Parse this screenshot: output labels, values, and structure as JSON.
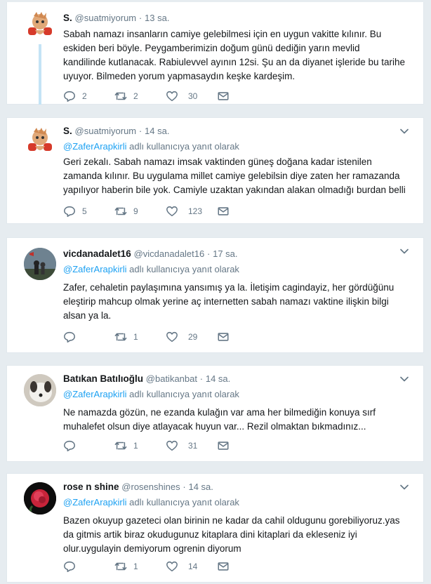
{
  "tweets": [
    {
      "name": "S.",
      "handle": "@suatmiyorum",
      "time": "13 sa.",
      "reply_to": "",
      "lines": [
        "Sabah namazı insanların camiye gelebilmesi için en uygun vakitte kılınır. Bu",
        "eskiden beri böyle. Peygamberimizin doğum günü dediğin yarın mevlid",
        "kandilinde kutlanacak. Rabiulevvel ayının 12si. Şu an da diyanet işleride bu tarihe",
        "uyuyor. Bilmeden yorum yapmasaydın keşke kardeşim."
      ],
      "replies": "2",
      "retweets": "2",
      "likes": "30"
    },
    {
      "name": "S.",
      "handle": "@suatmiyorum",
      "time": "14 sa.",
      "reply_to": "@ZaferArapkirli",
      "reply_suffix": "adlı kullanıcıya yanıt olarak",
      "lines": [
        "Geri zekalı. Sabah namazı imsak vaktinden güneş doğana kadar istenilen",
        "zamanda kılınır. Bu uygulama millet camiye gelebilsin diye zaten her ramazanda",
        "yapılıyor haberin bile yok. Camiyle uzaktan yakından alakan olmadığı burdan belli"
      ],
      "replies": "5",
      "retweets": "9",
      "likes": "123"
    },
    {
      "name": "vicdanadalet16",
      "handle": "@vicdanadalet16",
      "time": "17 sa.",
      "reply_to": "@ZaferArapkirli",
      "reply_suffix": "adlı kullanıcıya yanıt olarak",
      "lines": [
        "Zafer, cehaletin paylaşımına yansımış ya la. İletişim cagindayiz, her gördüğünu",
        "eleştirip mahcup olmak yerine aç internetten sabah namazı vaktine ilişkin bilgi",
        "alsan ya la."
      ],
      "replies": "",
      "retweets": "1",
      "likes": "29"
    },
    {
      "name": "Batıkan Batılıoğlu",
      "handle": "@batikanbat",
      "time": "14 sa.",
      "reply_to": "@ZaferArapkirli",
      "reply_suffix": "adlı kullanıcıya yanıt olarak",
      "lines": [
        "Ne namazda gözün, ne ezanda kulağın var ama her bilmediğin konuya sırf",
        "muhalefet olsun diye atlayacak huyun var... Rezil olmaktan bıkmadınız..."
      ],
      "replies": "",
      "retweets": "1",
      "likes": "31"
    },
    {
      "name": "rose n shine",
      "handle": "@rosenshines",
      "time": "14 sa.",
      "reply_to": "@ZaferArapkirli",
      "reply_suffix": "adlı kullanıcıya yanıt olarak",
      "lines": [
        "Bazen okuyup gazeteci olan birinin ne kadar da cahil oldugunu gorebiliyoruz.yas",
        "da gitmis artik biraz okudugunuz kitaplara dini kitaplari da ekleseniz iyi",
        "olur.uygulayin demiyorum ogrenin diyorum"
      ],
      "replies": "",
      "retweets": "1",
      "likes": "14"
    }
  ],
  "icons": {
    "reply": "reply-icon",
    "retweet": "retweet-icon",
    "like": "heart-icon",
    "dm": "envelope-icon",
    "more": "chevron-down-icon"
  },
  "colors": {
    "link": "#1da1f2",
    "muted": "#657786",
    "thread": "#c4e3f5"
  }
}
